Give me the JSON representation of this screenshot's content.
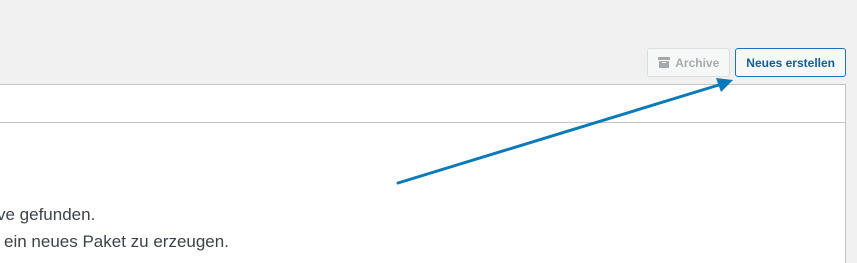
{
  "toolbar": {
    "archive_label": "Archive",
    "create_label": "Neues erstellen"
  },
  "message": {
    "line1": "ve gefunden.",
    "line2": "ein neues Paket zu erzeugen."
  },
  "colors": {
    "accent": "#2271b1",
    "arrow": "#0a7bb8",
    "panel_border": "#c3c4c7",
    "disabled_text": "#a7aaad"
  },
  "icons": {
    "archive": "archive-box-icon"
  }
}
